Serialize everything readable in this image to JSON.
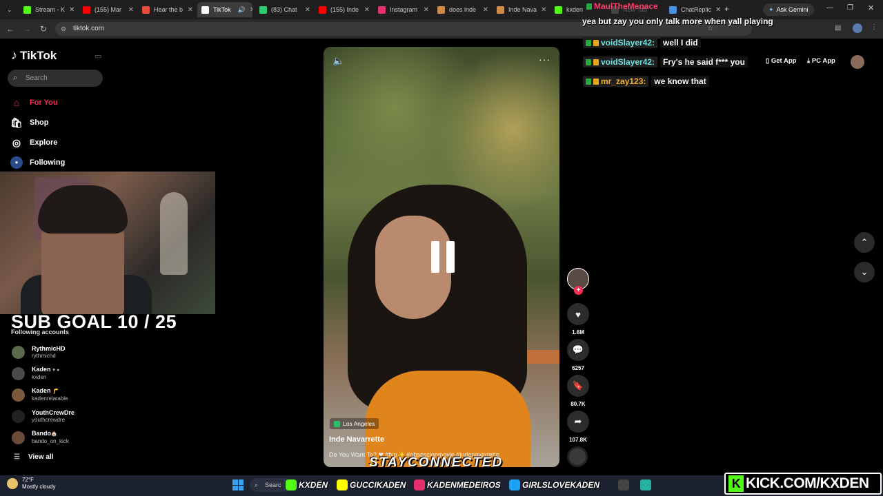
{
  "browser": {
    "tabs": [
      {
        "label": "Stream - K",
        "color": "#53fc18"
      },
      {
        "label": "(155) Mar",
        "color": "#ff0000"
      },
      {
        "label": "Hear the b",
        "color": "#e74c3c"
      },
      {
        "label": "TikTok",
        "color": "#ffffff"
      },
      {
        "label": "(83) Chat",
        "color": "#2ecc71"
      },
      {
        "label": "(155) Inde",
        "color": "#ff0000"
      },
      {
        "label": "Instagram",
        "color": "#e1306c"
      },
      {
        "label": "does inde",
        "color": "#d08a4a"
      },
      {
        "label": "Inde Nava",
        "color": "#d08a4a"
      },
      {
        "label": "kxden",
        "color": "#53fc18"
      },
      {
        "label": "New Tab",
        "color": "#888888"
      },
      {
        "label": "ChatReplic",
        "color": "#4a90e2"
      }
    ],
    "url": "tiktok.com",
    "ask_gemini": "Ask Gemini"
  },
  "sidebar": {
    "logo": "TikTok",
    "search_placeholder": "Search",
    "nav": [
      {
        "label": "For You",
        "icon": "home-icon",
        "active": true
      },
      {
        "label": "Shop",
        "icon": "shop-icon"
      },
      {
        "label": "Explore",
        "icon": "compass-icon"
      },
      {
        "label": "Following",
        "icon": "avatar-icon"
      }
    ],
    "following_title": "Following accounts",
    "accounts": [
      {
        "name": "RythmicHD",
        "handle": "rythmichd"
      },
      {
        "name": "Kaden",
        "handle": "kxden"
      },
      {
        "name": "Kaden",
        "handle": "kadenrelatable"
      },
      {
        "name": "YouthCrewDre",
        "handle": "youthcrewdre"
      },
      {
        "name": "Bando",
        "handle": "bando_on_kick"
      }
    ],
    "view_all": "View all"
  },
  "overlay": {
    "sub_goal": "SUB GOAL 10 / 25",
    "stay_connected": "STAYCONNECTED"
  },
  "video": {
    "location": "Los Angeles",
    "author": "Inde Navarrette",
    "caption": "Do You Want To? ❤ #fyp✨ #obsessionmovie #indenavarrette"
  },
  "actions": {
    "likes": "1.6M",
    "comments": "6257",
    "saves": "80.7K",
    "shares": "107.8K"
  },
  "chat": [
    {
      "user": "MaulTheMenace",
      "msg": "yea but zay you only talk more when yall playing",
      "color": "#ff3b6b"
    },
    {
      "user": "voidSlayer42:",
      "msg": "well I did",
      "color": "#6fe0e0"
    },
    {
      "user": "voidSlayer42:",
      "msg": "Fry's he said f*** you",
      "color": "#6fe0e0"
    },
    {
      "user": "mr_zay123:",
      "msg": "we know that",
      "color": "#f0b030"
    }
  ],
  "top_right": {
    "get_app": "Get App",
    "pc_app": "PC App"
  },
  "taskbar": {
    "temp": "72°F",
    "weather": "Mostly cloudy",
    "search": "Searc",
    "socials": [
      {
        "label": "KXDEN",
        "color": "#53fc18"
      },
      {
        "label": "GUCCIKADEN",
        "color": "#fffc00"
      },
      {
        "label": "KADENMEDEIROS",
        "color": "#e1306c"
      },
      {
        "label": "GIRLSLOVEKADEN",
        "color": "#1da1f2"
      }
    ],
    "kick_banner": "KICK.COM/KXDEN"
  }
}
